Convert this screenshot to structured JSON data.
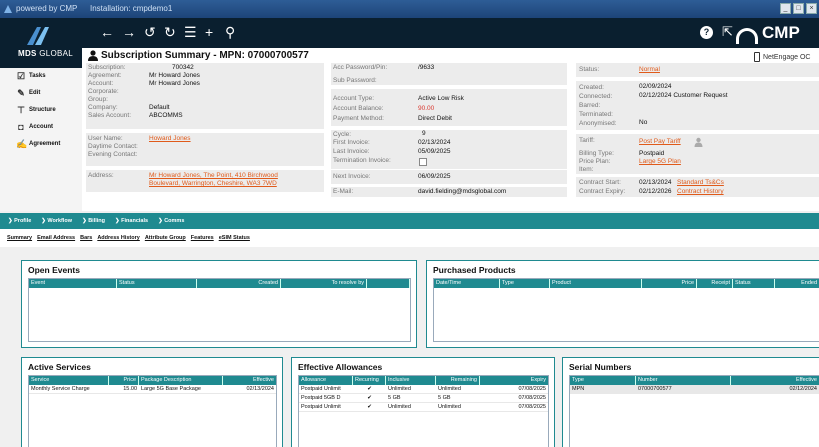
{
  "titlebar": {
    "powered": "powered by CMP",
    "installation": "Installation: cmpdemo1",
    "min": "_",
    "max": "□",
    "close": "×"
  },
  "brand": {
    "name_bold": "MDS",
    "name_rest": " GLOBAL",
    "product": "CMP"
  },
  "toolbar": {
    "back": "←",
    "forward": "→",
    "undo": "↺",
    "redo": "↻",
    "list": "☰",
    "add": "+",
    "search": "⚲",
    "help": "?",
    "popout": "⇱"
  },
  "sidebar": [
    {
      "label": "Tasks",
      "icon": "☑"
    },
    {
      "label": "Edit",
      "icon": "✎"
    },
    {
      "label": "Structure",
      "icon": "⊤"
    },
    {
      "label": "Account",
      "icon": "◘"
    },
    {
      "label": "Agreement",
      "icon": "✍"
    }
  ],
  "summary": {
    "title": "Subscription Summary - MPN: 07000700577",
    "device": "NetEngage OC",
    "col1": [
      {
        "label": "Subscription:",
        "value": "700342"
      },
      {
        "label": "Agreement:",
        "value": "Mr Howard Jones"
      },
      {
        "label": "Account:",
        "value": "Mr Howard Jones"
      },
      {
        "label": "Corporate:",
        "value": ""
      },
      {
        "label": "Group:",
        "value": ""
      },
      {
        "label": "Company:",
        "value": "Default"
      },
      {
        "label": "Sales Account:",
        "value": "ABCOMMS"
      },
      {
        "label": "User Name:",
        "value": "Howard Jones"
      },
      {
        "label": "Daytime Contact:",
        "value": ""
      },
      {
        "label": "Evening Contact:",
        "value": ""
      },
      {
        "label": "Address:",
        "value": "Mr Howard Jones, The Point, 410 Birchwood"
      },
      {
        "label": "",
        "value": "Boulevard, Warrington, Cheshire, WA3 7WD"
      }
    ],
    "col2": [
      {
        "label": "Acc Password/Pin:",
        "value": "/9633"
      },
      {
        "label": "Sub Password:",
        "value": ""
      },
      {
        "label": "Account Type:",
        "value": "Active Low Risk"
      },
      {
        "label": "Account Balance:",
        "value": "90.00"
      },
      {
        "label": "Payment Method:",
        "value": "Direct Debit"
      },
      {
        "label": "Cycle:",
        "value": "9"
      },
      {
        "label": "First Invoice:",
        "value": "02/13/2024"
      },
      {
        "label": "Last Invoice:",
        "value": "05/09/2025"
      },
      {
        "label": "Termination Invoice:",
        "value": ""
      },
      {
        "label": "Next Invoice:",
        "value": "06/09/2025"
      },
      {
        "label": "E-Mail:",
        "value": "david.fielding@mdsglobal.com"
      }
    ],
    "col3": [
      {
        "label": "Status:",
        "value": "Normal"
      },
      {
        "label": "Created:",
        "value": "02/09/2024"
      },
      {
        "label": "Connected:",
        "value": "02/12/2024 Customer Request"
      },
      {
        "label": "Barred:",
        "value": ""
      },
      {
        "label": "Terminated:",
        "value": ""
      },
      {
        "label": "Anonymised:",
        "value": "No"
      },
      {
        "label": "Tariff:",
        "value": "Post Pay Tariff"
      },
      {
        "label": "Billing Type:",
        "value": "Postpaid"
      },
      {
        "label": "Price Plan:",
        "value": "Large 5G Plan"
      },
      {
        "label": "Item:",
        "value": ""
      },
      {
        "label": "Contract Start:",
        "value": "02/13/2024",
        "link": "Standard Ts&Cs"
      },
      {
        "label": "Contract Expiry:",
        "value": "02/12/2026",
        "link": "Contract History"
      }
    ]
  },
  "nav": [
    "Profile",
    "Workflow",
    "Billing",
    "Financials",
    "Comms"
  ],
  "subtabs": [
    "Summary",
    "Email Address",
    "Bars",
    "Address History",
    "Attribute Group",
    "Features",
    "eSIM Status"
  ],
  "open_events": {
    "title": "Open Events",
    "headers": [
      "Event",
      "Status",
      "Created",
      "To resolve by"
    ]
  },
  "purchased_products": {
    "title": "Purchased Products",
    "headers": [
      "Date/Time",
      "Type",
      "Product",
      "Price",
      "Receipt",
      "Status",
      "Ended"
    ]
  },
  "active_services": {
    "title": "Active Services",
    "headers": [
      "Service",
      "Price",
      "Package Description",
      "Effective"
    ],
    "rows": [
      [
        "Monthly Service Charge",
        "15.00",
        "Large 5G Base Package",
        "02/13/2024"
      ]
    ]
  },
  "allowances": {
    "title": "Effective Allowances",
    "headers": [
      "Allowance",
      "Recurring",
      "Inclusive",
      "Remaining",
      "Expiry"
    ],
    "rows": [
      [
        "Postpaid Unlimit",
        "✔",
        "Unlimited",
        "Unlimited",
        "07/08/2025"
      ],
      [
        "Postpaid 5GB D",
        "✔",
        "5 GB",
        "5 GB",
        "07/08/2025"
      ],
      [
        "Postpaid Unlimit",
        "✔",
        "Unlimited",
        "Unlimited",
        "07/08/2025"
      ]
    ]
  },
  "serial_numbers": {
    "title": "Serial Numbers",
    "headers": [
      "Type",
      "Number",
      "Effective"
    ],
    "rows": [
      [
        "MPN",
        "07000700577",
        "02/12/2024"
      ]
    ]
  }
}
